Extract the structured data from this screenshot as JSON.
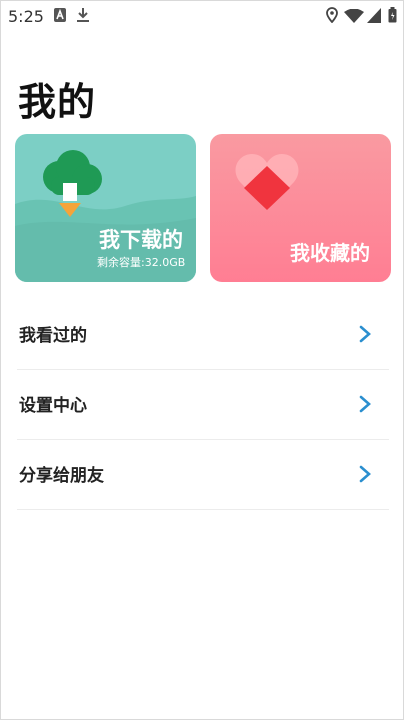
{
  "status_bar": {
    "time": "5:25",
    "icons": [
      "notification-a-icon",
      "download-icon",
      "location-icon",
      "wifi-icon",
      "signal-icon",
      "battery-icon"
    ]
  },
  "page": {
    "title": "我的"
  },
  "cards": {
    "downloads": {
      "label": "我下载的",
      "storage": "剩余容量:32.0GB",
      "icon": "cloud-download-icon"
    },
    "favorites": {
      "label": "我收藏的",
      "icon": "heart-icon"
    }
  },
  "menu": [
    {
      "label": "我看过的"
    },
    {
      "label": "设置中心"
    },
    {
      "label": "分享给朋友"
    }
  ],
  "colors": {
    "download_card": "#7ccfc5",
    "favorite_card": "#ff8a98",
    "chevron": "#2b8fcf",
    "cloud": "#1f9a55",
    "arrow": "#f5a43a"
  }
}
